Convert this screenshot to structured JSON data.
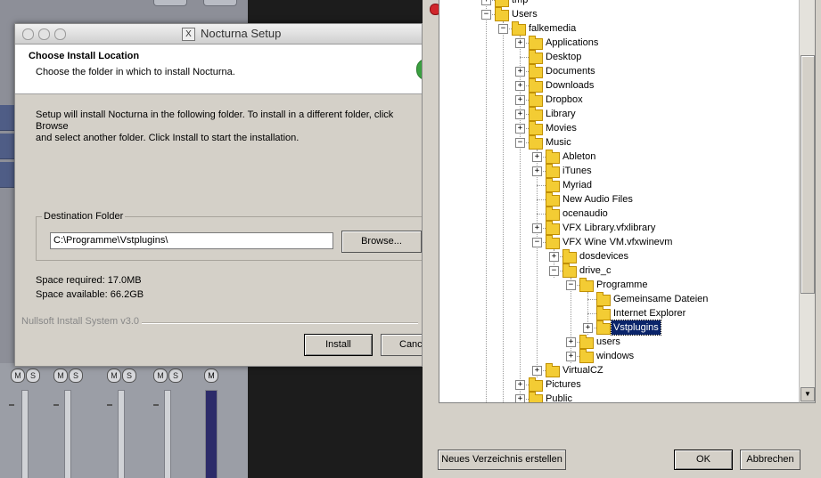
{
  "setup": {
    "window_title": "Nocturna Setup",
    "header_title": "Choose Install Location",
    "header_subtitle": "Choose the folder in which to install Nocturna.",
    "description_line1": "Setup will install Nocturna in the following folder. To install in a different folder, click Browse",
    "description_line2": "and select another folder. Click Install to start the installation.",
    "destination_label": "Destination Folder",
    "destination_value": "C:\\Programme\\Vstplugins\\",
    "browse_label": "Browse...",
    "space_required": "Space required: 17.0MB",
    "space_available": "Space available: 66.2GB",
    "branding": "Nullsoft Install System v3.0",
    "install_label": "Install",
    "cancel_label": "Cancel"
  },
  "mixer": {
    "mute_label": "M",
    "solo_label": "S"
  },
  "browser": {
    "new_folder_label": "Neues Verzeichnis erstellen",
    "ok_label": "OK",
    "cancel_label": "Abbrechen",
    "tree": [
      {
        "label": "tmp",
        "level": 0,
        "toggle": "+"
      },
      {
        "label": "Users",
        "level": 0,
        "toggle": "-"
      },
      {
        "label": "falkemedia",
        "level": 1,
        "toggle": "-"
      },
      {
        "label": "Applications",
        "level": 2,
        "toggle": "+"
      },
      {
        "label": "Desktop",
        "level": 2,
        "toggle": ""
      },
      {
        "label": "Documents",
        "level": 2,
        "toggle": "+"
      },
      {
        "label": "Downloads",
        "level": 2,
        "toggle": "+"
      },
      {
        "label": "Dropbox",
        "level": 2,
        "toggle": "+"
      },
      {
        "label": "Library",
        "level": 2,
        "toggle": "+"
      },
      {
        "label": "Movies",
        "level": 2,
        "toggle": "+"
      },
      {
        "label": "Music",
        "level": 2,
        "toggle": "-"
      },
      {
        "label": "Ableton",
        "level": 3,
        "toggle": "+"
      },
      {
        "label": "iTunes",
        "level": 3,
        "toggle": "+"
      },
      {
        "label": "Myriad",
        "level": 3,
        "toggle": ""
      },
      {
        "label": "New Audio Files",
        "level": 3,
        "toggle": ""
      },
      {
        "label": "ocenaudio",
        "level": 3,
        "toggle": ""
      },
      {
        "label": "VFX Library.vfxlibrary",
        "level": 3,
        "toggle": "+"
      },
      {
        "label": "VFX Wine VM.vfxwinevm",
        "level": 3,
        "toggle": "-"
      },
      {
        "label": "dosdevices",
        "level": 4,
        "toggle": "+"
      },
      {
        "label": "drive_c",
        "level": 4,
        "toggle": "-"
      },
      {
        "label": "Programme",
        "level": 5,
        "toggle": "-"
      },
      {
        "label": "Gemeinsame Dateien",
        "level": 6,
        "toggle": ""
      },
      {
        "label": "Internet Explorer",
        "level": 6,
        "toggle": ""
      },
      {
        "label": "Vstplugins",
        "level": 6,
        "toggle": "+",
        "selected": true
      },
      {
        "label": "users",
        "level": 5,
        "toggle": "+"
      },
      {
        "label": "windows",
        "level": 5,
        "toggle": "+"
      },
      {
        "label": "VirtualCZ",
        "level": 3,
        "toggle": "+"
      },
      {
        "label": "Pictures",
        "level": 2,
        "toggle": "+"
      },
      {
        "label": "Public",
        "level": 2,
        "toggle": "+"
      }
    ]
  },
  "colors": {
    "selection": "#0a246a",
    "folder": "#f3cc34",
    "dialog_bg": "#d4d0c8"
  }
}
